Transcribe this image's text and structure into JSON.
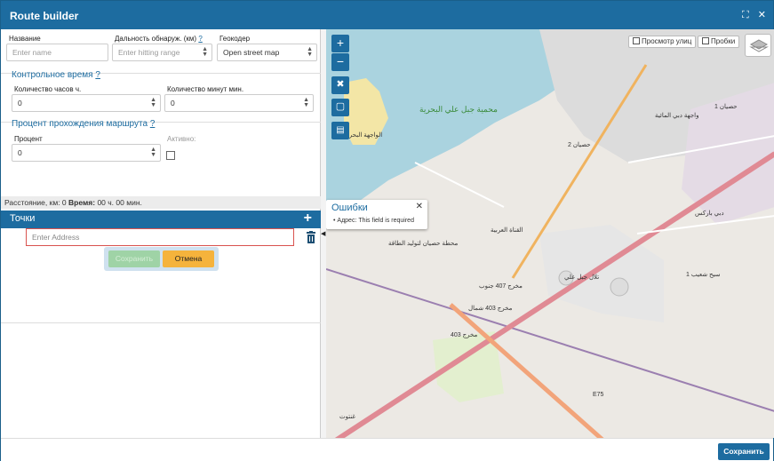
{
  "window": {
    "title": "Route builder",
    "restore_icon": "⛶",
    "close_icon": "✕"
  },
  "form": {
    "name_label": "Название",
    "name_placeholder": "Enter name",
    "range_label": "Дальность обнаруж. (км)",
    "range_help": "?",
    "range_placeholder": "Enter hitting range",
    "geocoder_label": "Геокодер",
    "geocoder_value": "Open street map"
  },
  "checkpoint": {
    "title": "Контрольное время",
    "help": "?",
    "hours_label": "Количество часов ч.",
    "hours_value": "0",
    "minutes_label": "Количество минут мин.",
    "minutes_value": "0"
  },
  "percent": {
    "title": "Процент прохождения маршрута",
    "help": "?",
    "percent_label": "Процент",
    "percent_value": "0",
    "active_label": "Активно:"
  },
  "status": {
    "distance": "Расстояние, км: 0",
    "time_label": "Время:",
    "time_value": "00 ч. 00 мин."
  },
  "points": {
    "title": "Точки",
    "add_icon": "+",
    "address_placeholder": "Enter Address"
  },
  "actions": {
    "save_label": "Сохранить",
    "cancel_label": "Отмена"
  },
  "map": {
    "zoom_in": "+",
    "zoom_out": "−",
    "street_view_label": "Просмотр улиц",
    "traffic_label": "Пробки",
    "errors_popup": {
      "title": "Ошибки",
      "close": "✕",
      "message": "Адрес: This field is required"
    },
    "labels": [
      "محمية جبل علي البحرية",
      "الواجهة البحرية",
      "حصيان 1",
      "واجهة دبي المائية",
      "حصيان 2",
      "مخرج 407 جنوب",
      "مخرج 403 شمال",
      "تلال جبل علي",
      "سيح شعيب 1",
      "دبي باركس",
      "غنتوت",
      "E75",
      "مخرج 403",
      "محطة حصيان لتوليد الطاقة",
      "القناة العربية"
    ]
  },
  "footer": {
    "submit_label": "Сохранить"
  }
}
